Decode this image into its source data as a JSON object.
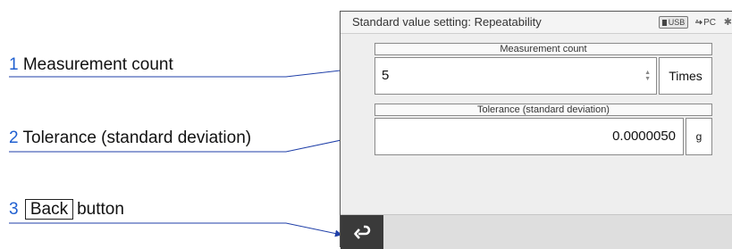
{
  "callouts": [
    {
      "num": "1",
      "text": "Measurement count"
    },
    {
      "num": "2",
      "text": "Tolerance (standard deviation)"
    },
    {
      "num": "3",
      "boxed": "Back",
      "text": "button"
    }
  ],
  "screen": {
    "title": "Standard value setting: Repeatability",
    "status": {
      "usb": "USB",
      "pc": "PC"
    },
    "measurement_count": {
      "header": "Measurement count",
      "value": "5",
      "unit": "Times"
    },
    "tolerance": {
      "header": "Tolerance (standard deviation)",
      "value": "0.0000050",
      "unit": "g"
    }
  },
  "icons": {
    "back": "return-arrow-icon",
    "usb": "usb-icon",
    "pc": "pc-link-icon",
    "bluetooth": "bluetooth-icon"
  }
}
